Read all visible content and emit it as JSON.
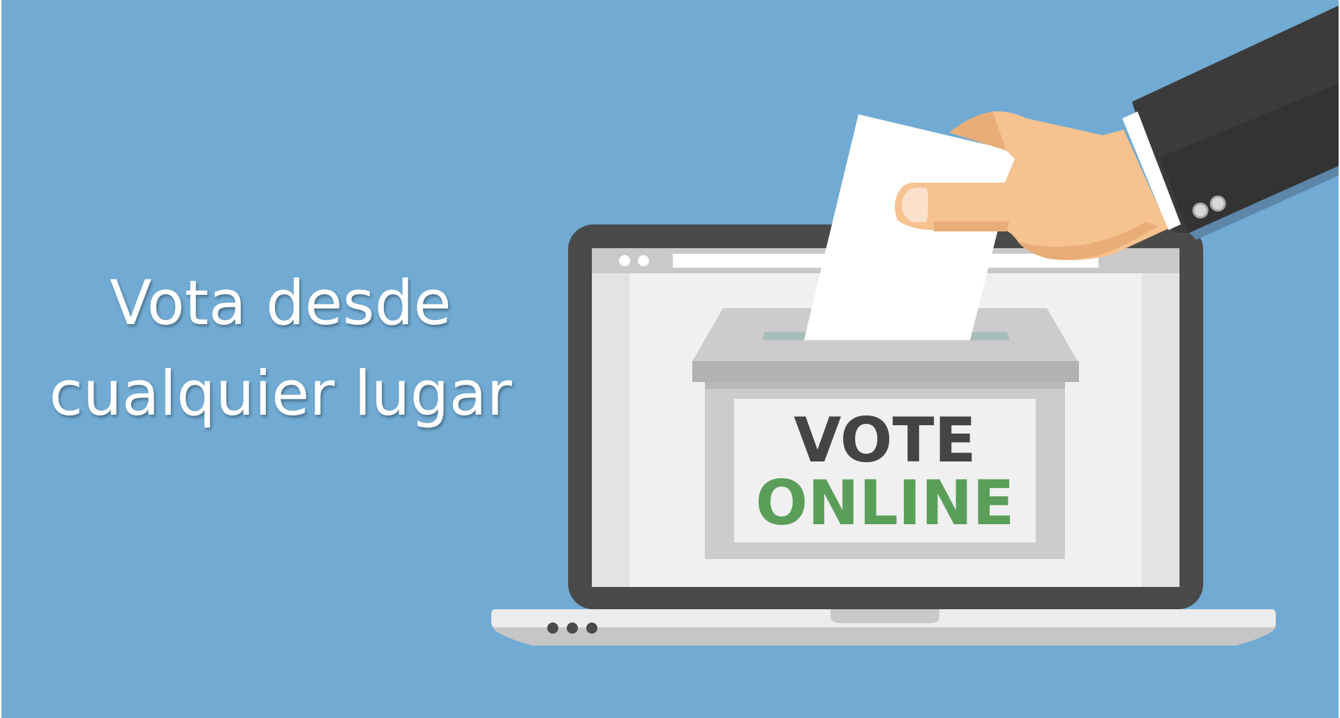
{
  "headline": {
    "line1": "Vota desde",
    "line2": "cualquier lugar"
  },
  "ballot_box": {
    "label_line1": "VOTE",
    "label_line2": "ONLINE"
  },
  "colors": {
    "background": "#71abd3",
    "laptop_frame": "#4a4a4a",
    "screen": "#f0f0f0",
    "label_vote": "#444444",
    "label_online": "#5a9e5a",
    "skin": "#f5c290",
    "suit": "#3b3b3b"
  }
}
